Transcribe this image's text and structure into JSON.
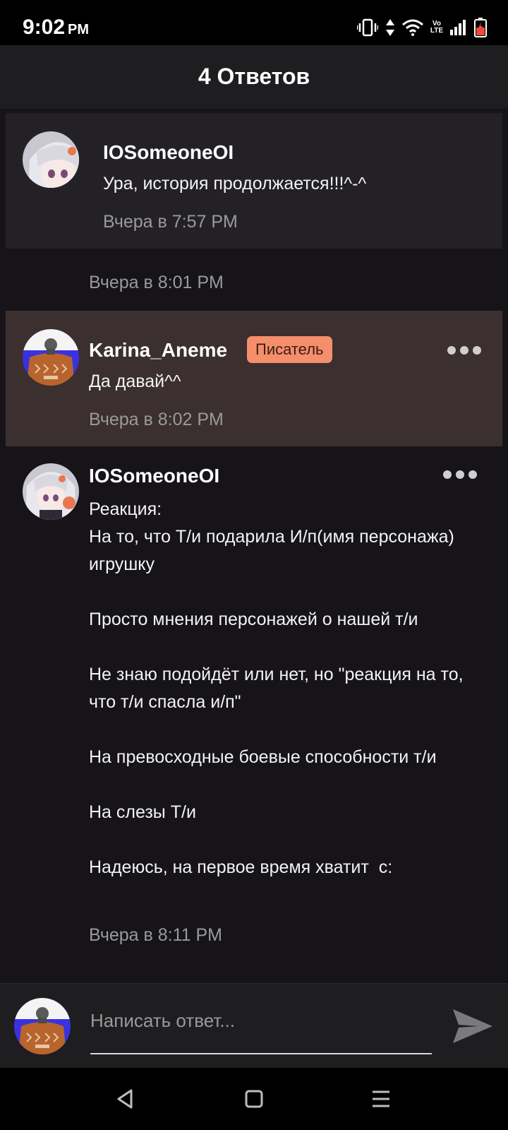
{
  "status_bar": {
    "time": "9:02",
    "ampm": "PM",
    "icons": [
      "vibrate-icon",
      "data-arrows-icon",
      "wifi-icon",
      "volte-icon",
      "signal-icon",
      "battery-icon"
    ],
    "volte_top": "Vo",
    "volte_bottom": "LTE"
  },
  "header": {
    "title": "4 Ответов"
  },
  "colors": {
    "background": "#161418",
    "header": "#1e1d20",
    "highlight": "#3b2f2f",
    "badge": "#f58e6a",
    "muted_text": "#9a9a9a"
  },
  "comments": [
    {
      "author": "IOSomeoneOI",
      "text": "Ура, история продолжается!!!^-^",
      "time": "Вчера в 7:57 PM",
      "pinned": true
    },
    {
      "author": "",
      "text": "",
      "time": "Вчера в 8:01 PM"
    },
    {
      "author": "Karina_Aneme",
      "badge": "Писатель",
      "text": "Да давай^^",
      "time": "Вчера в 8:02 PM",
      "highlighted": true
    },
    {
      "author": "IOSomeoneOI",
      "text": "Реакция:\nНа то, что Т/и подарила И/п(имя персонажа) игрушку\n\nПросто мнения персонажей о нашей т/и\n\nНе знаю подойдёт или нет, но \"реакция на то, что т/и спасла и/п\"\n\nНа превосходные боевые способности т/и\n\nНа слезы Т/и\n\nНадеюсь, на первое время хватит  с:",
      "time": "Вчера в 8:11 PM"
    }
  ],
  "reply": {
    "placeholder": "Написать ответ..."
  },
  "nav": {
    "icons": [
      "back-icon",
      "home-icon",
      "menu-icon"
    ]
  }
}
